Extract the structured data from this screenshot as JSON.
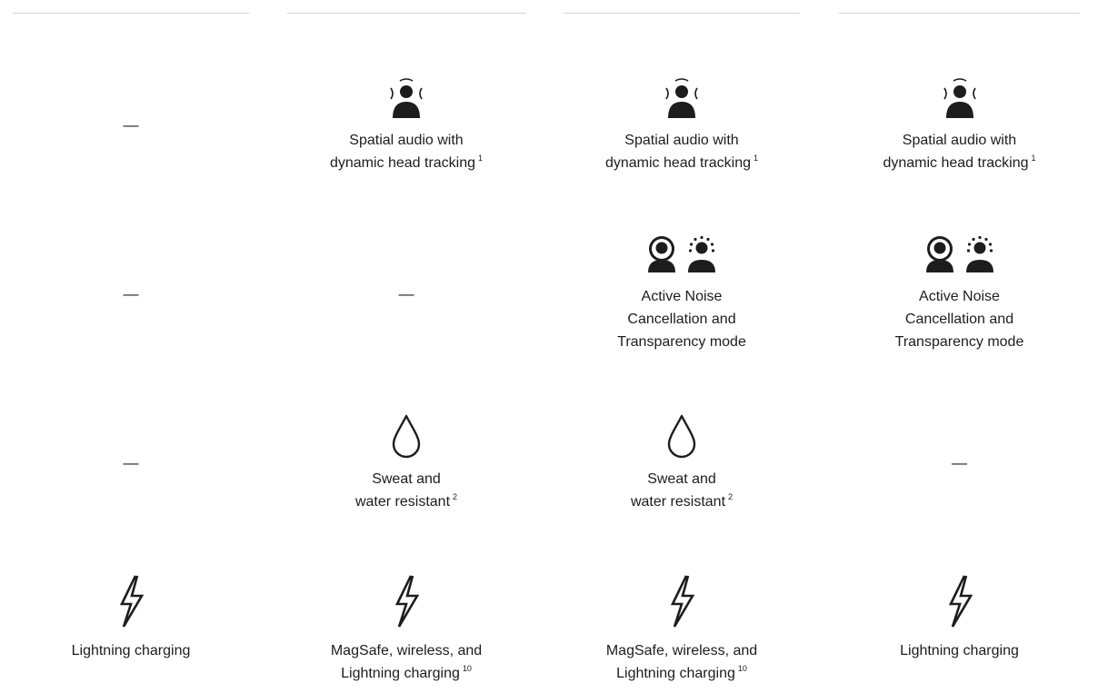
{
  "columns": [
    {
      "spatial": {
        "dash": "—"
      },
      "anc": {
        "dash": "—"
      },
      "water": {
        "dash": "—"
      },
      "charging": {
        "line1": "Lightning charging",
        "line2": "",
        "footnote": ""
      }
    },
    {
      "spatial": {
        "line1": "Spatial audio with",
        "line2": "dynamic head tracking",
        "footnote": "1"
      },
      "anc": {
        "dash": "—"
      },
      "water": {
        "line1": "Sweat and",
        "line2": "water resistant",
        "footnote": "2"
      },
      "charging": {
        "line1": "MagSafe, wireless, and",
        "line2": "Lightning charging",
        "footnote": "10"
      }
    },
    {
      "spatial": {
        "line1": "Spatial audio with",
        "line2": "dynamic head tracking",
        "footnote": "1"
      },
      "anc": {
        "line1": "Active Noise",
        "line2": "Cancellation and",
        "line3": "Transparency mode"
      },
      "water": {
        "line1": "Sweat and",
        "line2": "water resistant",
        "footnote": "2"
      },
      "charging": {
        "line1": "MagSafe, wireless, and",
        "line2": "Lightning charging",
        "footnote": "10"
      }
    },
    {
      "spatial": {
        "line1": "Spatial audio with",
        "line2": "dynamic head tracking",
        "footnote": "1"
      },
      "anc": {
        "line1": "Active Noise",
        "line2": "Cancellation and",
        "line3": "Transparency mode"
      },
      "water": {
        "dash": "—"
      },
      "charging": {
        "line1": "Lightning charging",
        "line2": "",
        "footnote": ""
      }
    }
  ],
  "icons": {
    "spatial": "spatial-audio-icon",
    "anc": "noise-cancellation-icon",
    "transparency": "transparency-mode-icon",
    "water": "water-drop-icon",
    "charging": "lightning-bolt-icon"
  }
}
